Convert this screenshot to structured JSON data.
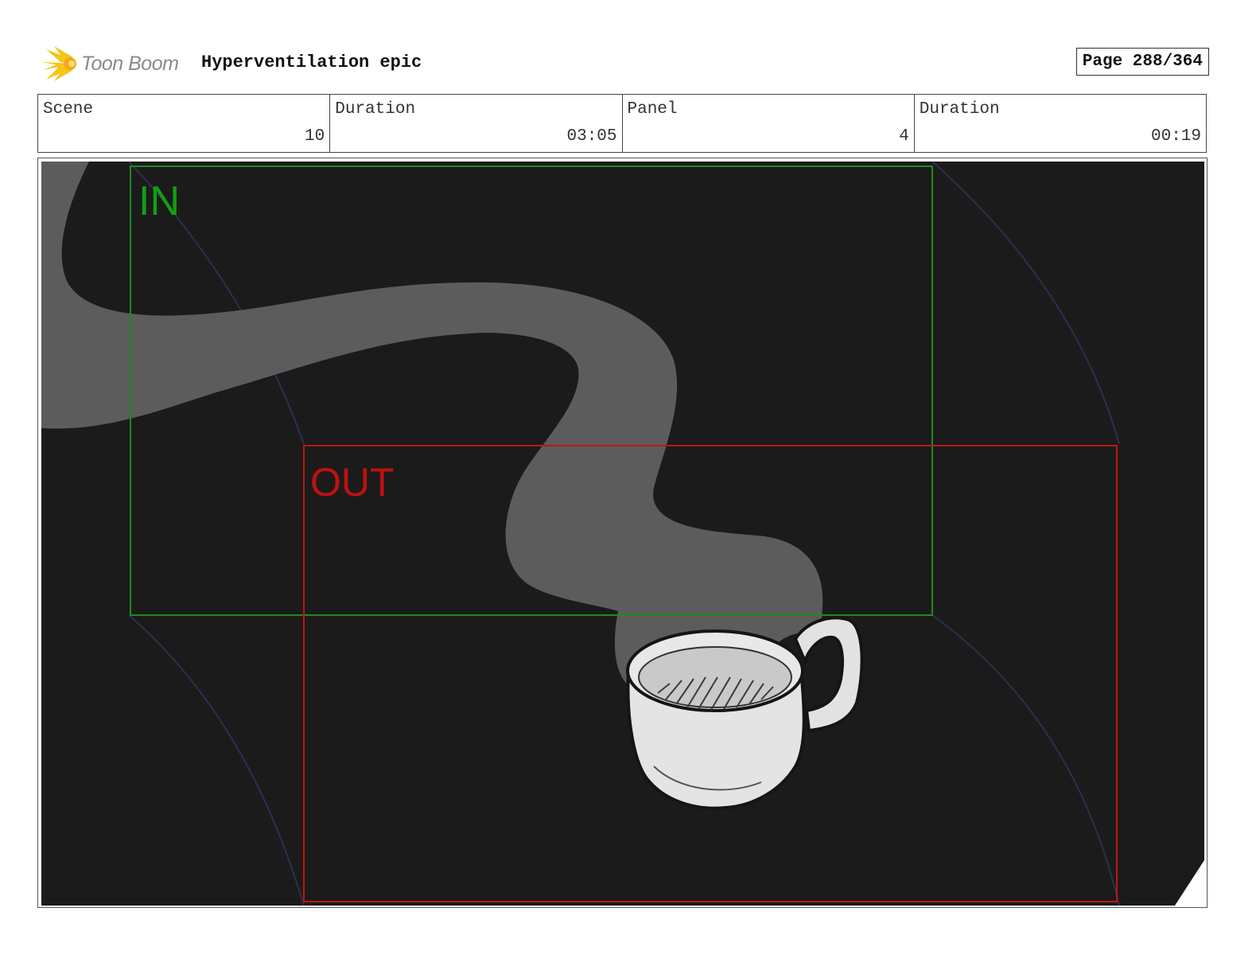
{
  "header": {
    "logo_text": "Toon Boom",
    "project_title": "Hyperventilation epic",
    "page_label": "Page 288/364"
  },
  "info": {
    "scene_label": "Scene",
    "scene_value": "10",
    "scene_duration_label": "Duration",
    "scene_duration_value": "03:05",
    "panel_label": "Panel",
    "panel_value": "4",
    "panel_duration_label": "Duration",
    "panel_duration_value": "00:19"
  },
  "panel": {
    "in_label": "IN",
    "out_label": "OUT",
    "colors": {
      "background": "#1b1b1b",
      "steam": "#5c5c5c",
      "in_frame": "#1f8a1f",
      "out_frame": "#c21414",
      "cup": "#e4e4e4"
    }
  }
}
